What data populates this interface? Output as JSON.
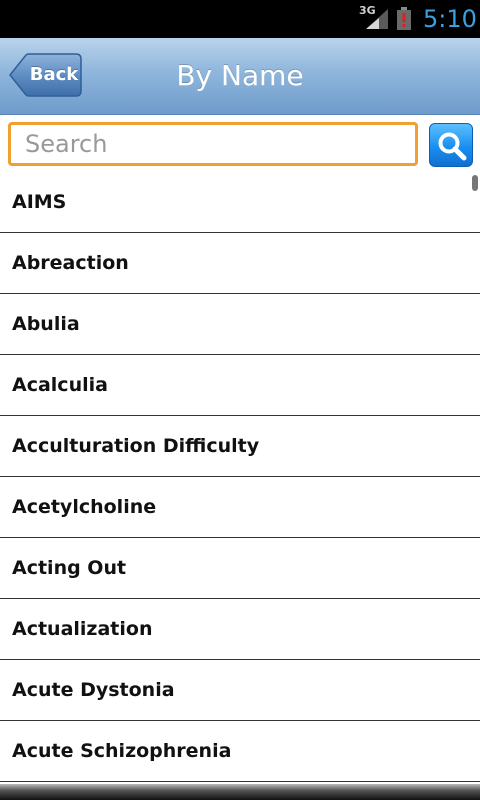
{
  "status_bar": {
    "network": "3G",
    "time": "5:10"
  },
  "header": {
    "back_label": "Back",
    "title": "By Name"
  },
  "search": {
    "placeholder": "Search",
    "value": ""
  },
  "colors": {
    "search_border": "#f0a030",
    "header_top": "#b9d3ec",
    "header_bottom": "#6e9bcb",
    "clock": "#3aa0e0",
    "search_button": "#1a8ff0"
  },
  "icons": {
    "signal": "signal-icon",
    "battery": "battery-alert-icon",
    "back": "back-arrow-button",
    "search": "magnifier-icon"
  },
  "list": {
    "items": [
      {
        "label": "AIMS"
      },
      {
        "label": "Abreaction"
      },
      {
        "label": "Abulia"
      },
      {
        "label": "Acalculia"
      },
      {
        "label": "Acculturation Difficulty"
      },
      {
        "label": "Acetylcholine"
      },
      {
        "label": "Acting Out"
      },
      {
        "label": "Actualization"
      },
      {
        "label": "Acute Dystonia"
      },
      {
        "label": "Acute Schizophrenia"
      }
    ]
  }
}
